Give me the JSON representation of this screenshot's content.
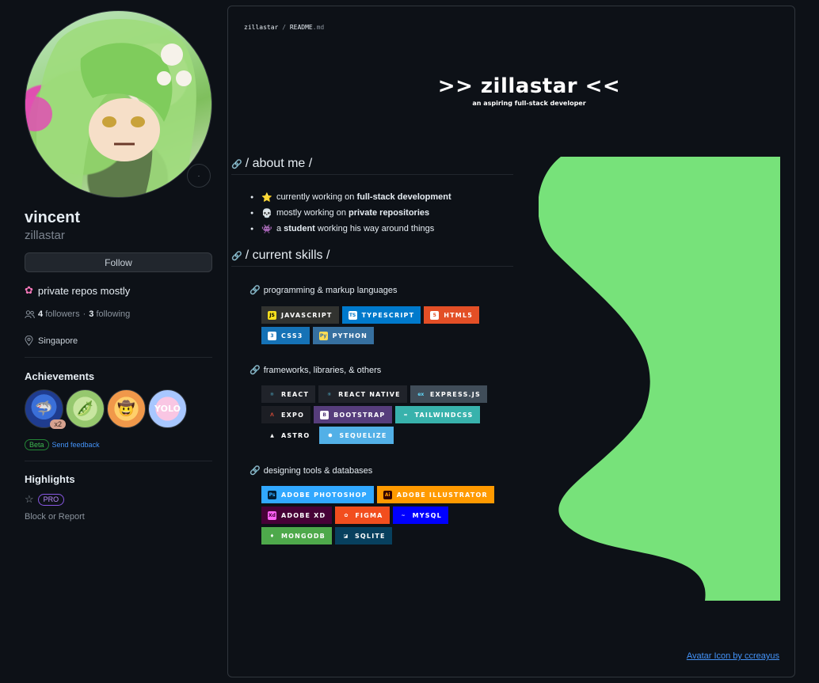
{
  "profile": {
    "display_name": "vincent",
    "username": "zillastar",
    "follow_label": "Follow",
    "bio": "private repos mostly",
    "followers_count": "4",
    "followers_label": "followers",
    "dot": "·",
    "following_count": "3",
    "following_label": "following",
    "location": "Singapore",
    "status_emoji": "·"
  },
  "achievements": {
    "title": "Achievements",
    "items": [
      {
        "name": "shark",
        "count": "x2"
      },
      {
        "name": "pea-pod"
      },
      {
        "name": "cowboy"
      },
      {
        "name": "yolo"
      }
    ],
    "beta": "Beta",
    "feedback": "Send feedback"
  },
  "highlights": {
    "title": "Highlights",
    "pro": "PRO",
    "block": "Block or Report"
  },
  "readme": {
    "path_owner": "zillastar",
    "path_sep": "/",
    "path_file": "README",
    "path_ext": ".md",
    "logo_title": ">> zillastar <<",
    "logo_sub": "an aspiring full-stack developer",
    "about_heading": "/ about me /",
    "about_items": [
      {
        "icon": "⭐",
        "pre": "currently working on ",
        "bold": "full-stack development",
        "post": ""
      },
      {
        "icon": "💀",
        "pre": "mostly working on ",
        "bold": "private repositories",
        "post": ""
      },
      {
        "icon": "👾",
        "pre": "a ",
        "bold": "student",
        "post": " working his way around things"
      }
    ],
    "skills_heading": "/ current skills /",
    "group1_title": "programming & markup languages",
    "group2_title": "frameworks, libraries, & others",
    "group3_title": "designing tools & databases",
    "group1": [
      [
        {
          "label": "JAVASCRIPT",
          "bg": "#323330",
          "icon_bg": "#F7DF1E",
          "icon_fg": "#000000",
          "icon_text": "JS"
        },
        {
          "label": "TYPESCRIPT",
          "bg": "#007ACC",
          "icon_bg": "#ffffff",
          "icon_fg": "#007ACC",
          "icon_text": "TS"
        },
        {
          "label": "HTML5",
          "bg": "#E34F26",
          "icon_bg": "#ffffff",
          "icon_fg": "#E34F26",
          "icon_text": "5"
        }
      ],
      [
        {
          "label": "CSS3",
          "bg": "#1572B6",
          "icon_bg": "#ffffff",
          "icon_fg": "#1572B6",
          "icon_text": "3"
        },
        {
          "label": "PYTHON",
          "bg": "#3670A0",
          "icon_bg": "#FFDD54",
          "icon_fg": "#3670A0",
          "icon_text": "Py"
        }
      ]
    ],
    "group2": [
      [
        {
          "label": "REACT",
          "bg": "#20232a",
          "icon_bg": "transparent",
          "icon_fg": "#61DAFB",
          "icon_text": "⚛"
        },
        {
          "label": "REACT NATIVE",
          "bg": "#20232a",
          "icon_bg": "transparent",
          "icon_fg": "#61DAFB",
          "icon_text": "⚛"
        },
        {
          "label": "EXPRESS.JS",
          "bg": "#404d59",
          "icon_bg": "transparent",
          "icon_fg": "#61DAFB",
          "icon_text": "ex"
        }
      ],
      [
        {
          "label": "EXPO",
          "bg": "#1C1E24",
          "icon_bg": "transparent",
          "icon_fg": "#D04A37",
          "icon_text": "Λ"
        },
        {
          "label": "BOOTSTRAP",
          "bg": "#563D7C",
          "icon_bg": "#ffffff",
          "icon_fg": "#563D7C",
          "icon_text": "B"
        },
        {
          "label": "TAILWINDCSS",
          "bg": "#38B2AC",
          "icon_bg": "transparent",
          "icon_fg": "#ffffff",
          "icon_text": "≈"
        }
      ],
      [
        {
          "label": "ASTRO",
          "bg": "#0d1117",
          "icon_bg": "transparent",
          "icon_fg": "#ffffff",
          "icon_text": "▲"
        },
        {
          "label": "SEQUELIZE",
          "bg": "#52B0E7",
          "icon_bg": "transparent",
          "icon_fg": "#ffffff",
          "icon_text": "⬢"
        }
      ]
    ],
    "group3": [
      [
        {
          "label": "ADOBE PHOTOSHOP",
          "bg": "#31A8FF",
          "icon_bg": "#001E36",
          "icon_fg": "#31A8FF",
          "icon_text": "Ps"
        },
        {
          "label": "ADOBE ILLUSTRATOR",
          "bg": "#FF9A00",
          "icon_bg": "#330000",
          "icon_fg": "#FF9A00",
          "icon_text": "Ai"
        }
      ],
      [
        {
          "label": "ADOBE XD",
          "bg": "#470137",
          "icon_bg": "#FF61F6",
          "icon_fg": "#470137",
          "icon_text": "Xd"
        },
        {
          "label": "FIGMA",
          "bg": "#F24E1E",
          "icon_bg": "transparent",
          "icon_fg": "#ffffff",
          "icon_text": "✿"
        },
        {
          "label": "MYSQL",
          "bg": "#0000FF",
          "icon_bg": "transparent",
          "icon_fg": "#ffffff",
          "icon_text": "~"
        }
      ],
      [
        {
          "label": "MONGODB",
          "bg": "#4EA94B",
          "icon_bg": "transparent",
          "icon_fg": "#ffffff",
          "icon_text": "♦"
        },
        {
          "label": "SQLITE",
          "bg": "#07405E",
          "icon_bg": "transparent",
          "icon_fg": "#ffffff",
          "icon_text": "◪"
        }
      ]
    ],
    "credit": "Avatar Icon by ccreayus"
  },
  "colors": {
    "background": "#0d1117",
    "border": "#30363d",
    "link": "#4493f8",
    "wave": "#77e27a"
  }
}
